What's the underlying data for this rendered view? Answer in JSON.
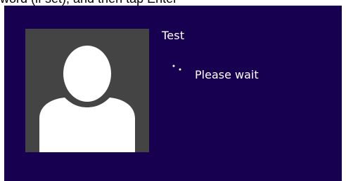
{
  "caption": {
    "text": "word (if set), and then tap Enter"
  },
  "lock_screen": {
    "background_color": "#180050",
    "tile_color": "#444444",
    "user_name": "Test",
    "status_text": "Please wait",
    "avatar_icon": "default-user-icon",
    "spinner_icon": "loading-dots-icon"
  }
}
